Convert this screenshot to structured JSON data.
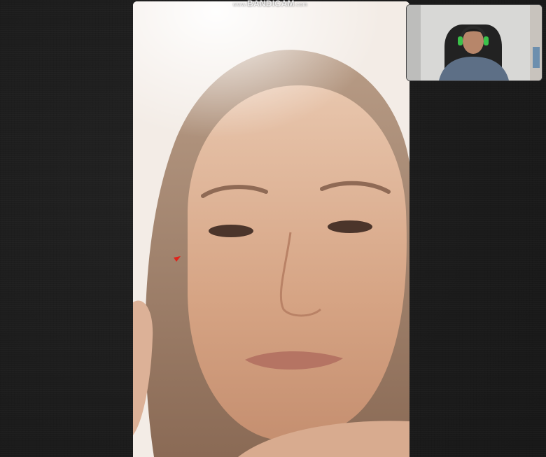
{
  "watermark": {
    "prefix": "www.",
    "brand": "BANDICAM",
    "suffix": ".com"
  },
  "call": {
    "remote_feed": "remote-participant-video",
    "local_feed": "self-view-video"
  },
  "colors": {
    "background": "#1c1c1c",
    "cursor_marker": "#e0231b"
  }
}
